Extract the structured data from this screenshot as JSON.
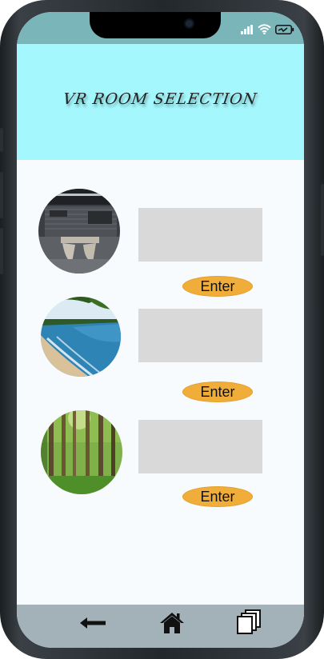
{
  "header": {
    "title": "VR ROOM SELECTION"
  },
  "rooms": [
    {
      "name": "office-room",
      "image": "office-lounge-photo",
      "enter_label": "Enter",
      "description": ""
    },
    {
      "name": "beach-room",
      "image": "beach-photo",
      "enter_label": "Enter",
      "description": ""
    },
    {
      "name": "forest-room",
      "image": "forest-photo",
      "enter_label": "Enter",
      "description": ""
    }
  ],
  "nav": {
    "back_icon": "back-arrow-icon",
    "home_icon": "home-icon",
    "pages_icon": "copy-pages-icon"
  },
  "colors": {
    "status_bar": "#7ab5b9",
    "header_bg": "#a4f7fc",
    "content_bg": "#f7fbfd",
    "enter_button": "#f0ad3a",
    "placeholder_box": "#d9d9d9",
    "bottom_nav": "#a3b2b8"
  }
}
